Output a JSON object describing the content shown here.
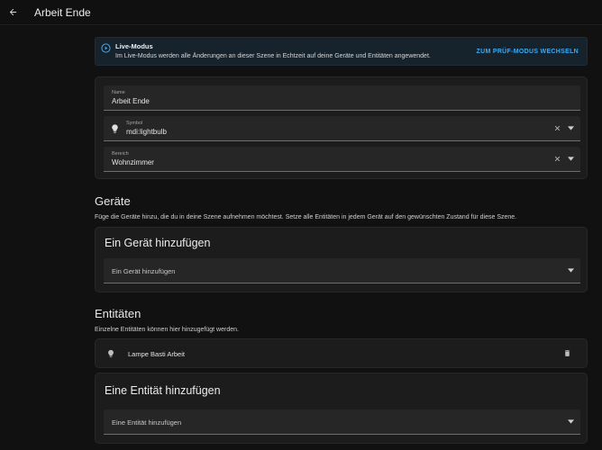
{
  "topbar": {
    "title": "Arbeit Ende"
  },
  "live_info": {
    "title": "Live-Modus",
    "text": "Im Live-Modus werden alle Änderungen an dieser Szene in Echtzeit auf deine Geräte und Entitäten angewendet.",
    "action": "ZUM PRÜF-MODUS WECHSELN",
    "accent_color": "#3ea9f0"
  },
  "scene_form": {
    "name": {
      "label": "Name",
      "value": "Arbeit Ende"
    },
    "icon": {
      "label": "Symbol",
      "value": "mdi:lightbulb",
      "icon": "lightbulb-icon"
    },
    "area": {
      "label": "Bereich",
      "value": "Wohnzimmer"
    }
  },
  "devices": {
    "title": "Geräte",
    "description": "Füge die Geräte hinzu, die du in deine Szene aufnehmen möchtest. Setze alle Entitäten in jedem Gerät auf den gewünschten Zustand für diese Szene.",
    "add_card_title": "Ein Gerät hinzufügen",
    "add_placeholder": "Ein Gerät hinzufügen"
  },
  "entities": {
    "title": "Entitäten",
    "description": "Einzelne Entitäten können hier hinzugefügt werden.",
    "items": [
      {
        "name": "Lampe Basti Arbeit",
        "icon": "lightbulb-icon"
      }
    ],
    "add_card_title": "Eine Entität hinzufügen",
    "add_placeholder": "Eine Entität hinzufügen"
  }
}
